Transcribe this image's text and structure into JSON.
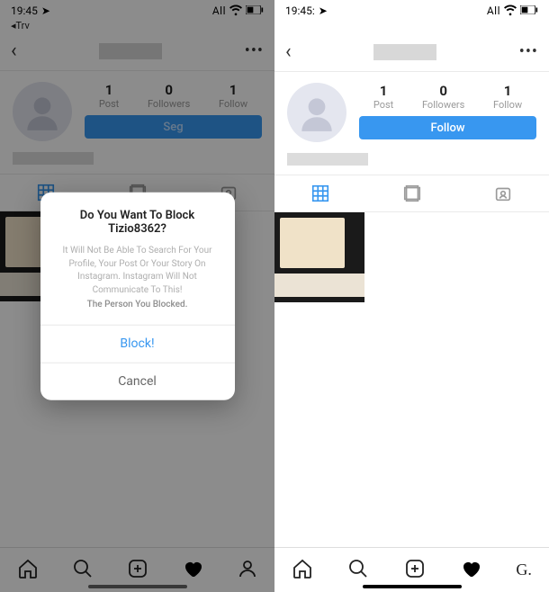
{
  "status": {
    "time": "19:45",
    "sub": "◂Trv",
    "carrier": "All",
    "time_right": "19:45:"
  },
  "profile": {
    "stats": [
      {
        "num": "1",
        "label": "Post"
      },
      {
        "num": "0",
        "label": "Followers"
      },
      {
        "num": "1",
        "label": "Follow"
      }
    ],
    "follow_label_left": "Seg",
    "follow_label_right": "Follow"
  },
  "modal": {
    "title": "Do You Want To Block Tizio8362?",
    "msg_line1": "It Will Not Be Able To Search For Your Profile, Your",
    "msg_line2": "Post Or Your Story On Instagram.",
    "msg_line3": "Instagram Will Not Communicate To This!",
    "msg_emphasis": "The Person You Blocked.",
    "block": "Block!",
    "cancel": "Cancel"
  },
  "bottom_nav": {
    "extra_label": "G."
  }
}
